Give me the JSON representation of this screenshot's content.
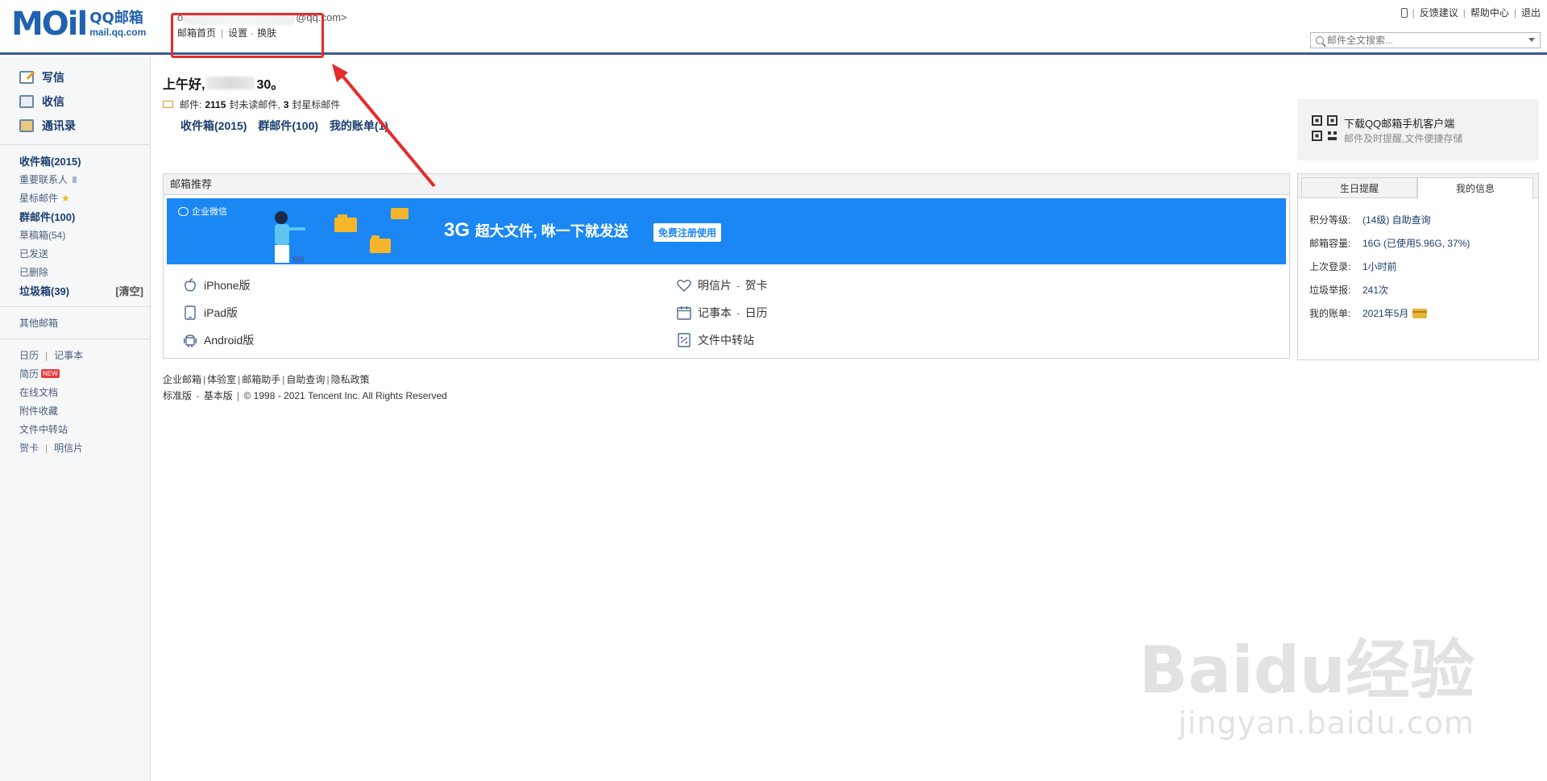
{
  "header": {
    "logo_text": "MOil",
    "logo_cn": "QQ邮箱",
    "logo_domain": "mail.qq.com",
    "email_prefix": "o",
    "email_suffix": "@qq.com>",
    "link_home": "邮箱首页",
    "link_settings": "设置",
    "link_skin": "换肤",
    "link_feedback": "反馈建议",
    "link_help": "帮助中心",
    "link_logout": "退出",
    "search_placeholder": "邮件全文搜索..."
  },
  "sidebar": {
    "write": "写信",
    "inbox_main": "收信",
    "contacts": "通讯录",
    "inbox": "收件箱(2015)",
    "important": "重要联系人",
    "starred": "星标邮件",
    "group": "群邮件(100)",
    "drafts": "草稿箱(54)",
    "sent": "已发送",
    "deleted": "已删除",
    "spam": "垃圾箱(39)",
    "clear": "[清空]",
    "other": "其他邮箱",
    "calendar": "日历",
    "notes": "记事本",
    "resume": "简历",
    "new_badge": "NEW",
    "docs": "在线文档",
    "attach": "附件收藏",
    "transfer": "文件中转站",
    "greeting_card": "贺卡",
    "postcard": "明信片"
  },
  "main": {
    "greeting_prefix": "上午好,",
    "greeting_suffix": "30。",
    "mail_label": "邮件:",
    "unread_count": "2115",
    "unread_text": "封未读邮件,",
    "star_count": "3",
    "star_text": "封星标邮件",
    "quick_inbox": "收件箱(2015)",
    "quick_group": "群邮件(100)",
    "quick_bill": "我的账单(1)",
    "promo_title": "邮箱推荐",
    "banner_brand": "企业微信",
    "banner_big": "3G",
    "banner_text": "超大文件, 咻一下就发送",
    "banner_btn": "免费注册使用",
    "app_iphone": "iPhone版",
    "app_ipad": "iPad版",
    "app_android": "Android版",
    "app_postcard": "明信片",
    "app_card": "贺卡",
    "app_notes": "记事本",
    "app_calendar": "日历",
    "app_transfer": "文件中转站",
    "dash": "-"
  },
  "footer": {
    "l1": "企业邮箱",
    "l2": "体验室",
    "l3": "邮箱助手",
    "l4": "自助查询",
    "l5": "隐私政策",
    "line2_a": "标准版",
    "line2_b": "基本版",
    "copyright": "© 1998 - 2021 Tencent Inc. All Rights Reserved"
  },
  "right": {
    "ad_title": "下载QQ邮箱手机客户端",
    "ad_sub": "邮件及时提醒,文件便捷存储",
    "tab_birthday": "生日提醒",
    "tab_myinfo": "我的信息",
    "rows": [
      {
        "k": "积分等级:",
        "v": "(14级)  自助查询"
      },
      {
        "k": "邮箱容量:",
        "v": "16G (已使用5.96G, 37%)"
      },
      {
        "k": "上次登录:",
        "v": "1小时前"
      },
      {
        "k": "垃圾举报:",
        "v": "241次"
      },
      {
        "k": "我的账单:",
        "v": "2021年5月"
      }
    ]
  },
  "watermark": {
    "brand": "Baidu经验",
    "url": "jingyan.baidu.com"
  },
  "colors": {
    "brand_blue": "#1f62b0",
    "banner_blue": "#1a87f5",
    "highlight_red": "#e52b2b"
  }
}
